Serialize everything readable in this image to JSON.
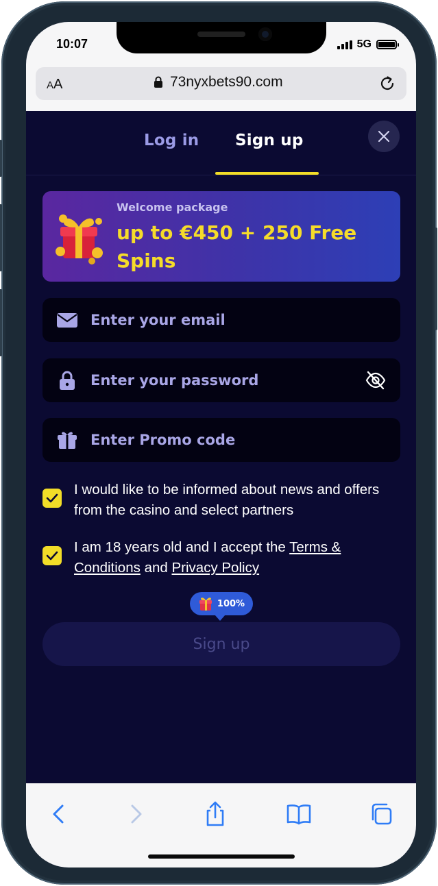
{
  "status_bar": {
    "time": "10:07",
    "network": "5G"
  },
  "browser": {
    "text_size_small": "A",
    "text_size_large": "A",
    "url": "73nyxbets90.com"
  },
  "auth": {
    "tabs": [
      {
        "label": "Log in"
      },
      {
        "label": "Sign up"
      }
    ],
    "active_tab": "Sign up"
  },
  "promo": {
    "label": "Welcome package",
    "title": "up to €450 + 250 Free Spins"
  },
  "form": {
    "email_placeholder": "Enter your email",
    "password_placeholder": "Enter your password",
    "promo_placeholder": "Enter Promo code",
    "consent_news": "I would like to be informed about news and offers from the casino and select partners",
    "consent_age_prefix": "I am 18 years old and I accept the ",
    "terms_link": "Terms & Conditions",
    "consent_age_middle": " and ",
    "privacy_link": "Privacy Policy",
    "bonus_badge": "100%",
    "submit_label": "Sign up"
  },
  "colors": {
    "background": "#0b0a32",
    "accent_yellow": "#f2dd28",
    "field_background": "#030212",
    "placeholder": "#a9a6e6",
    "badge_blue": "#2f5bd8"
  },
  "icons": [
    "lock-icon",
    "reload-icon",
    "close-icon",
    "gift-icon",
    "mail-icon",
    "padlock-icon",
    "eye-off-icon",
    "present-icon",
    "checkmark-icon",
    "back-icon",
    "forward-icon",
    "share-icon",
    "bookmarks-icon",
    "tabs-icon"
  ]
}
